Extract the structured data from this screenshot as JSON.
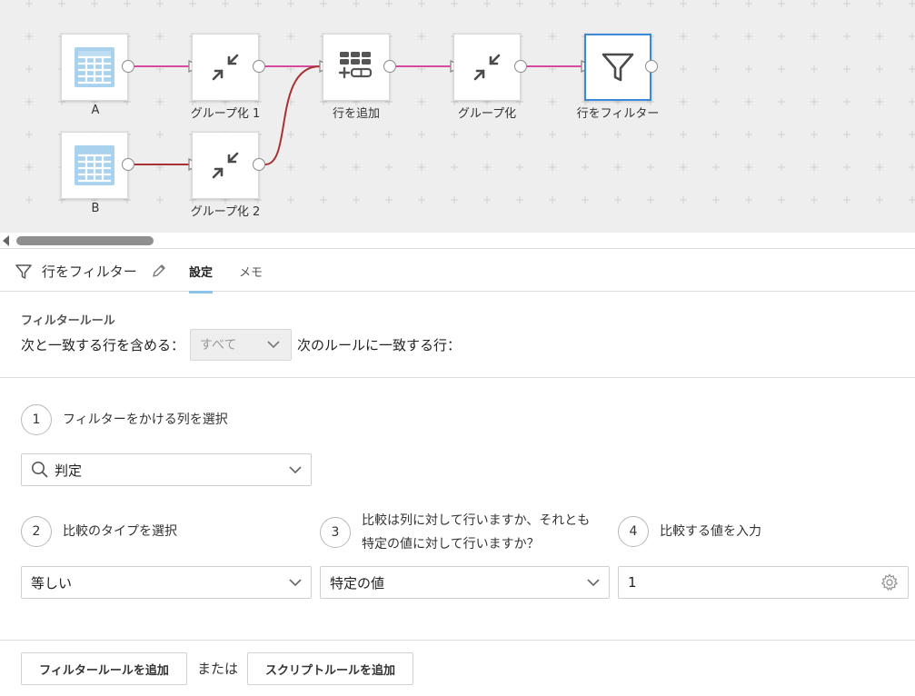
{
  "canvas": {
    "nodes": [
      {
        "id": "a",
        "label": "A",
        "icon": "table-icon"
      },
      {
        "id": "group1",
        "label": "グループ化 1",
        "icon": "collapse-icon"
      },
      {
        "id": "addrows",
        "label": "行を追加",
        "icon": "add-rows-icon"
      },
      {
        "id": "group",
        "label": "グループ化",
        "icon": "collapse-icon"
      },
      {
        "id": "filter",
        "label": "行をフィルター",
        "icon": "filter-icon",
        "selected": true
      },
      {
        "id": "b",
        "label": "B",
        "icon": "table-icon"
      },
      {
        "id": "group2",
        "label": "グループ化 2",
        "icon": "collapse-icon"
      }
    ],
    "colors": {
      "background": "#eeeeee",
      "link_pink": "#d6499b",
      "link_red": "#a83232",
      "selected_border": "#3b8ad9",
      "table_icon": "#a9d2ee"
    }
  },
  "panel": {
    "title": "行をフィルター",
    "tabs": [
      {
        "label": "設定",
        "active": true
      },
      {
        "label": "メモ",
        "active": false
      }
    ]
  },
  "filter_rule": {
    "section_title": "フィルタールール",
    "include_prefix": "次と一致する行を含める：",
    "match_select": "すべて",
    "include_suffix": "次のルールに一致する行："
  },
  "steps": {
    "s1": {
      "num": "1",
      "text": "フィルターをかける列を選択",
      "column_value": "判定"
    },
    "s2": {
      "num": "2",
      "text": "比較のタイプを選択",
      "value": "等しい"
    },
    "s3": {
      "num": "3",
      "text_line1": "比較は列に対して行いますか、それとも",
      "text_line2": "特定の値に対して行いますか？",
      "value": "特定の値"
    },
    "s4": {
      "num": "4",
      "text": "比較する値を入力",
      "value": "1"
    }
  },
  "footer": {
    "add_filter_rule": "フィルタールールを追加",
    "or": "または",
    "add_script_rule": "スクリプトルールを追加"
  }
}
